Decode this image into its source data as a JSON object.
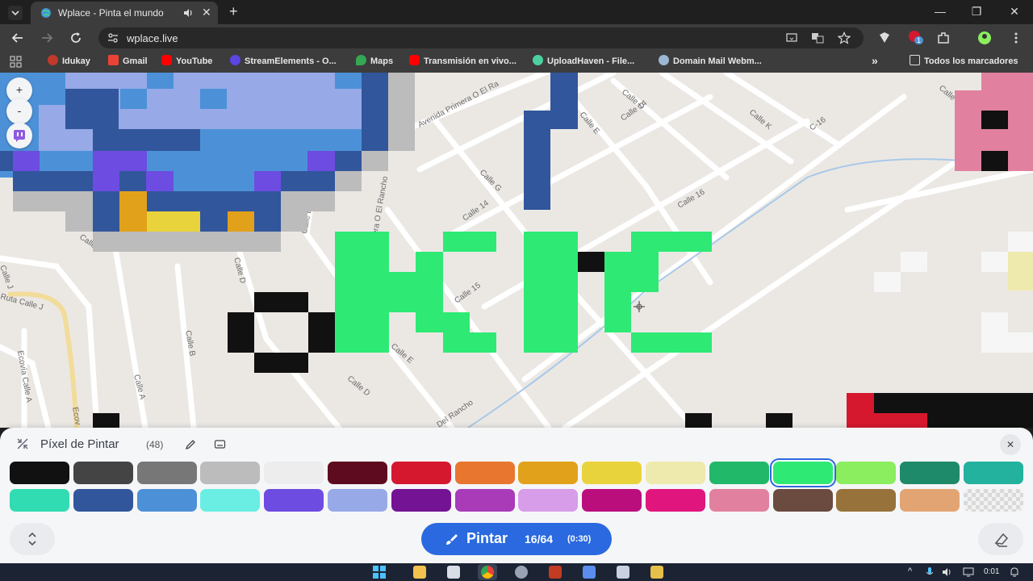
{
  "browser": {
    "tab_title": "Wplace - Pinta el mundo",
    "tab_close": "✕",
    "new_tab": "+",
    "url": "wplace.live",
    "extension_badge": "1",
    "window_controls": {
      "minimize": "—",
      "restore": "❐",
      "close": "✕"
    }
  },
  "bookmarks": {
    "items": [
      {
        "label": "Idukay",
        "color": "#c0392b"
      },
      {
        "label": "Gmail",
        "color": "#ea4335"
      },
      {
        "label": "YouTube",
        "color": "#ff0000"
      },
      {
        "label": "StreamElements - O...",
        "color": "#5b46e2"
      },
      {
        "label": "Maps",
        "color": "#34a853"
      },
      {
        "label": "Transmisión en vivo...",
        "color": "#ff0000"
      },
      {
        "label": "UploadHaven - File...",
        "color": "#4dd0a0"
      },
      {
        "label": "Domain Mail Webm...",
        "color": "#9bb7d4"
      }
    ],
    "overflow": "»",
    "all_bookmarks": "Todos los marcadores"
  },
  "map": {
    "zoom_in": "+",
    "zoom_out": "-",
    "streets": [
      "Avenida Primera O El Ra",
      "Calle D",
      "Calle E",
      "Calle 14",
      "Calle K",
      "C-16",
      "Calle G",
      "Calle 14",
      "Calle 16",
      "mera O El Rancho",
      "Calle E",
      "Calle",
      "Calle J",
      "Calle D",
      "Calle 15",
      "Ruta Calle J",
      "Calle B",
      "Calle E",
      "Ecovía Calle A",
      "Calle A",
      "Calle D",
      "Del Rancho",
      "Ecov",
      "Calle"
    ]
  },
  "panel": {
    "title": "Píxel de Pintar",
    "count": "(48)",
    "paint_label": "Pintar",
    "paint_progress": "16/64",
    "paint_timer": "(0:30)",
    "selected_color": "#2eea74",
    "palette_row1": [
      "#111111",
      "#444444",
      "#777777",
      "#bcbcbc",
      "#ededed",
      "#5e0b1f",
      "#d6182f",
      "#e8762f",
      "#e2a11a",
      "#e9d33c",
      "#eeeaae",
      "#22b869",
      "#2eea74",
      "#8aee5e",
      "#1f8a69",
      "#22b29e"
    ],
    "palette_row2": [
      "#31dcb2",
      "#31569c",
      "#4c91d7",
      "#6aeee3",
      "#6d4ce1",
      "#97a9e7",
      "#741394",
      "#a93bb9",
      "#d79de8",
      "#bb0e7d",
      "#e0167e",
      "#e1819f",
      "#6b4a40",
      "#97723a",
      "#e3a474",
      "transparent"
    ]
  },
  "taskbar": {
    "time": "0:01",
    "tray_up": "^"
  }
}
